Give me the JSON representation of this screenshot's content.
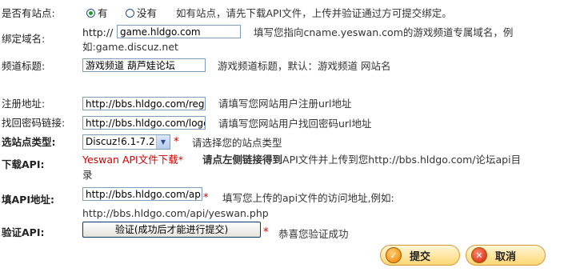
{
  "has_site": {
    "label": "是否有站点:",
    "option_yes": "有",
    "option_no": "没有",
    "help": "如有站点，请先下载API文件，上传并验证通过方可提交绑定。"
  },
  "domain": {
    "label": "绑定域名:",
    "prefix": "http://",
    "value": "game.hldgo.com",
    "help_line1": "填写您指向cname.yeswan.com的游戏频道专属域名，例",
    "help_line2": "如:game.discuz.net"
  },
  "channel_title": {
    "label": "频道标题:",
    "value": "游戏频道 葫芦娃论坛",
    "help": "游戏频道标题，默认：游戏频道 网站名"
  },
  "register_url": {
    "label": "注册地址:",
    "value": "http://bbs.hldgo.com/regis",
    "help": "请填写您网站用户注册url地址"
  },
  "recover_url": {
    "label": "找回密码链接:",
    "value": "http://bbs.hldgo.com/loggi",
    "help": "请填写您网站用户找回密码url地址"
  },
  "site_type": {
    "label": "选站点类型:",
    "selected": "Discuz!6.1-7.2",
    "star": "*",
    "help": "请选择您的站点类型"
  },
  "download_api": {
    "label": "下载API:",
    "link": "Yeswan API文件下载",
    "star": "*",
    "help_bold": "请点左侧链接得到",
    "help_rest_line1": "API文件并上传到您http://bbs.hldgo.com/论坛api目",
    "help_line2": "录"
  },
  "api_address": {
    "label": "填API地址:",
    "value": "http://bbs.hldgo.com/api/y",
    "star": "*",
    "help": "填写您上传的api文件的访问地址,例如:",
    "example": "http://bbs.hldgo.com/api/yeswan.php"
  },
  "verify_api": {
    "label": "验证API:",
    "button": "验证(成功后才能进行提交)",
    "star": "*",
    "status": "恭喜您验证成功"
  },
  "actions": {
    "submit": "提交",
    "cancel": "取消"
  }
}
